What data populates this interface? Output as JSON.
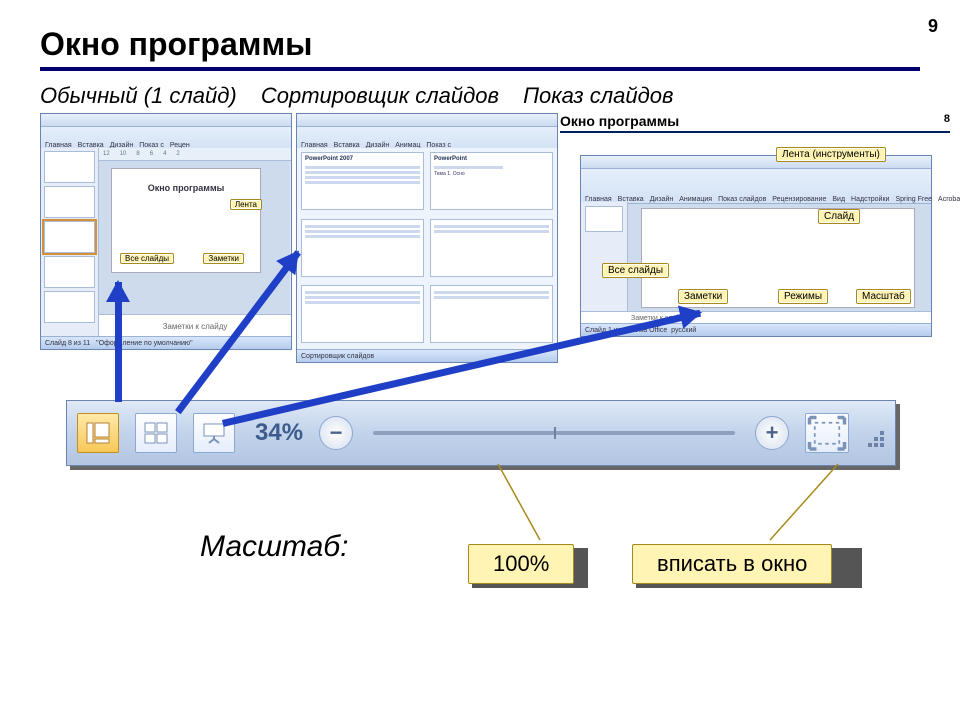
{
  "page_number": "9",
  "title": "Окно программы",
  "modes": {
    "normal": "Обычный (1 слайд)",
    "sorter": "Сортировщик слайдов",
    "slideshow": "Показ слайдов"
  },
  "win1": {
    "ribbon": [
      "Главная",
      "Вставка",
      "Дизайн",
      "Показ с",
      "Рецен"
    ],
    "ruler": [
      "12",
      "10",
      "8",
      "6",
      "4",
      "2"
    ],
    "slide_title": "Окно программы",
    "notes": "Заметки к слайду",
    "status_left": "Слайд 8 из 11",
    "status_theme": "\"Оформление по умолчанию\"",
    "callout_all": "Все слайды",
    "callout_notes": "Заметки",
    "callout_ribbon": "Лента"
  },
  "win2": {
    "ribbon": [
      "Главная",
      "Вставка",
      "Дизайн",
      "Анимац",
      "Показ с"
    ],
    "mini1_title": "PowerPoint 2007",
    "mini2_title": "PowerPoint",
    "mini2_sub": "Тема 1. Осно",
    "status": "Сортировщик слайдов"
  },
  "win3": {
    "title": "Окно программы",
    "num": "8",
    "ribbon": [
      "Главная",
      "Вставка",
      "Дизайн",
      "Анимация",
      "Показ слайдов",
      "Рецензирование",
      "Вид",
      "Надстройки",
      "Spring Free",
      "Acrobat"
    ],
    "callouts": {
      "ribbon": "Лента (инструменты)",
      "slide": "Слайд",
      "all": "Все слайды",
      "notes": "Заметки",
      "modes": "Режимы",
      "zoom": "Масштаб"
    },
    "notes": "Заметки к слайду",
    "status_left": "Слайд 1 из 1",
    "status_theme": "Тема Office",
    "status_lang": "русский"
  },
  "zoom": {
    "percent": "34%"
  },
  "scale_label": "Масштаб:",
  "tag_100": "100%",
  "tag_fit": "вписать в окно"
}
